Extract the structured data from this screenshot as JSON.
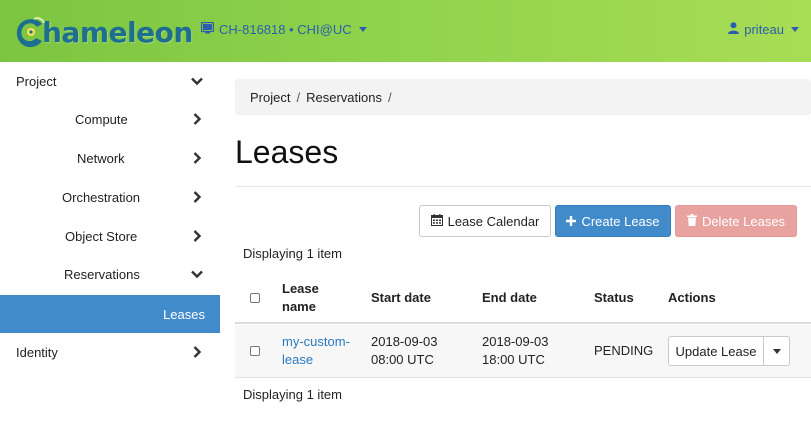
{
  "header": {
    "logo_text": "hameleon",
    "project_switcher": "CH-816818 • CHI@UC",
    "user": "priteau",
    "colors": {
      "bar": "#8fd24c",
      "link": "#2b5fae"
    }
  },
  "sidebar": {
    "items": [
      {
        "label": "Project",
        "chevron": "down"
      },
      {
        "label": "Compute",
        "chevron": "right"
      },
      {
        "label": "Network",
        "chevron": "right"
      },
      {
        "label": "Orchestration",
        "chevron": "right"
      },
      {
        "label": "Object Store",
        "chevron": "right"
      },
      {
        "label": "Reservations",
        "chevron": "down"
      },
      {
        "label": "Leases",
        "chevron": "none",
        "active": true
      },
      {
        "label": "Identity",
        "chevron": "right"
      }
    ],
    "active_color": "#428bca"
  },
  "breadcrumb": [
    "Project",
    "Reservations"
  ],
  "page_title": "Leases",
  "toolbar": {
    "calendar_label": "Lease Calendar",
    "create_label": "Create Lease",
    "delete_label": "Delete Leases"
  },
  "display_count": "Displaying 1 item",
  "table": {
    "columns": [
      "Lease name",
      "Start date",
      "End date",
      "Status",
      "Actions"
    ],
    "rows": [
      {
        "name_line1": "my-custom-",
        "name_line2": "lease",
        "start_line1": "2018-09-03",
        "start_line2": "08:00 UTC",
        "end_line1": "2018-09-03",
        "end_line2": "18:00 UTC",
        "status": "PENDING",
        "action": "Update Lease"
      }
    ]
  }
}
